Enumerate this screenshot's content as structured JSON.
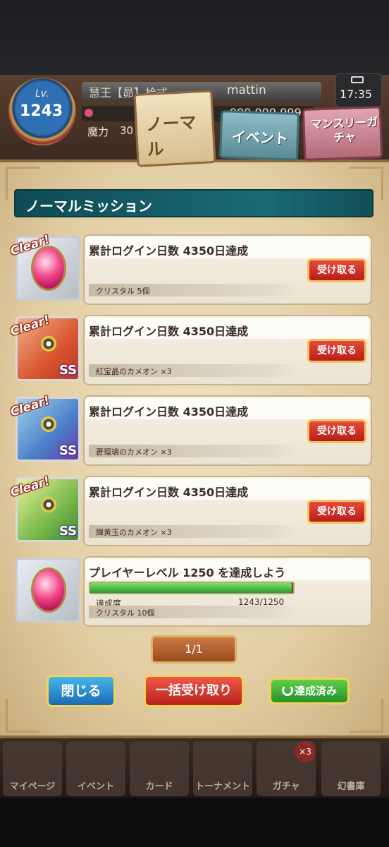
{
  "header": {
    "level_label": "Lv.",
    "level_value": "1243",
    "title": "慧王【昴】拾式",
    "player_name": "mattin",
    "gem_value": "999,999,999",
    "power_label": "魔力",
    "power_value": "30",
    "time": "17:35"
  },
  "tabs": [
    {
      "label": "ノーマル",
      "active": true
    },
    {
      "label": "イベント",
      "active": false
    },
    {
      "label": "マンスリーガチャ",
      "active": false
    }
  ],
  "section_title": "ノーマルミッション",
  "missions": [
    {
      "clear_tag": "Clear!",
      "title": "累計ログイン日数 4350日達成",
      "reward": "クリスタル 5個",
      "button": "受け取る",
      "icon": "crystal-icon"
    },
    {
      "clear_tag": "Clear!",
      "title": "累計ログイン日数 4350日達成",
      "reward": "紅宝晶のカメオン ×3",
      "button": "受け取る",
      "icon": "red-chameleon-icon"
    },
    {
      "clear_tag": "Clear!",
      "title": "累計ログイン日数 4350日達成",
      "reward": "蒼瑠璃のカメオン ×3",
      "button": "受け取る",
      "icon": "blue-chameleon-icon"
    },
    {
      "clear_tag": "Clear!",
      "title": "累計ログイン日数 4350日達成",
      "reward": "輝黄玉のカメオン ×3",
      "button": "受け取る",
      "icon": "green-chameleon-icon"
    }
  ],
  "progress_mission": {
    "title": "プレイヤーレベル 1250 を達成しよう",
    "progress_label": "達成度",
    "progress_count": "1243/1250",
    "progress_fraction": 0.9944,
    "reward": "クリスタル 10個",
    "icon": "crystal-icon"
  },
  "pager": "1/1",
  "buttons": {
    "close": "閉じる",
    "bulk_receive": "一括受け取り",
    "completed": "達成済み"
  },
  "bottom_nav": [
    {
      "label": "マイページ",
      "icon": "house-icon"
    },
    {
      "label": "イベント",
      "icon": "event-icon"
    },
    {
      "label": "カード",
      "icon": "card-icon"
    },
    {
      "label": "トーナメント",
      "icon": "trophy-icon"
    },
    {
      "label": "ガチャ",
      "icon": "gacha-icon",
      "badge": "×3"
    },
    {
      "label": "幻書庫",
      "icon": "library-icon"
    }
  ],
  "colors": {
    "teal_header": "#1a6a76",
    "claim_red": "#b71e18",
    "progress_green": "#2e9a2a",
    "parchment": "#e3cfa4"
  }
}
